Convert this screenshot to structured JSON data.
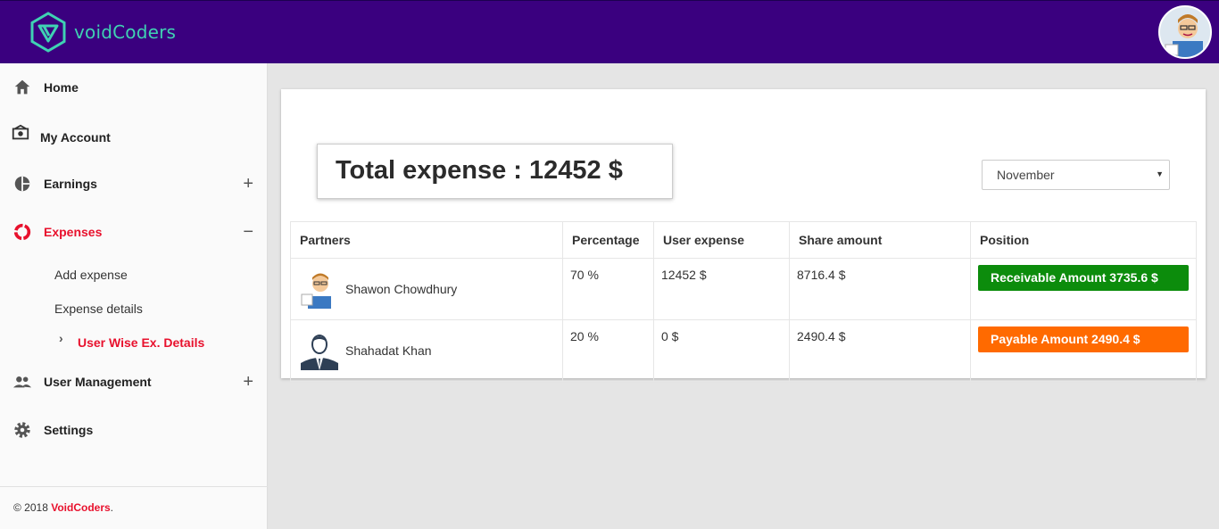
{
  "brand": {
    "name": "voidCoders",
    "teal": "#3fd2b3",
    "header_color": "#3a007f"
  },
  "header": {
    "avatar": "user-avatar"
  },
  "sidebar": {
    "items": [
      {
        "label": "Home",
        "icon": "home-icon"
      },
      {
        "label": "My Account",
        "icon": "account-icon"
      },
      {
        "label": "Earnings",
        "icon": "pie-chart-icon",
        "toggle": "+"
      },
      {
        "label": "Expenses",
        "icon": "donut-icon",
        "toggle": "−",
        "active": true
      },
      {
        "label": "User Management",
        "icon": "users-icon",
        "toggle": "+"
      },
      {
        "label": "Settings",
        "icon": "gear-icon"
      }
    ],
    "expenses_sub": [
      {
        "label": "Add expense"
      },
      {
        "label": "Expense details"
      },
      {
        "label": "User Wise Ex. Details",
        "active": true
      }
    ],
    "footer": {
      "prefix": "© 2018 ",
      "brand": "VoidCoders",
      "suffix": "."
    },
    "accent": "#e8112d"
  },
  "main": {
    "total_label": "Total expense : 12452 $",
    "month": {
      "selected": "November"
    },
    "table": {
      "headers": [
        "Partners",
        "Percentage",
        "User expense",
        "Share amount",
        "Position"
      ],
      "rows": [
        {
          "name": "Shawon Chowdhury",
          "percentage": "70 %",
          "user_expense": "12452 $",
          "share": "8716.4 $",
          "position": "Receivable Amount 3735.6 $",
          "position_color": "#0c8c0c"
        },
        {
          "name": "Shahadat Khan",
          "percentage": "20 %",
          "user_expense": "0 $",
          "share": "2490.4 $",
          "position": "Payable Amount 2490.4 $",
          "position_color": "#ff6a00"
        }
      ]
    }
  }
}
